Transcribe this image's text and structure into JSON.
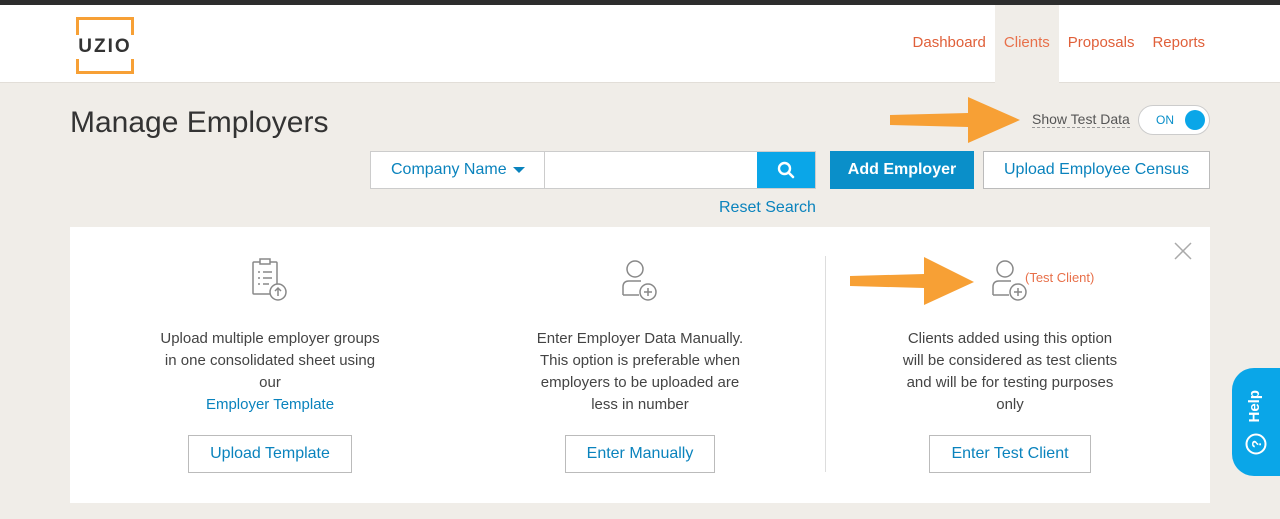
{
  "brand": {
    "logo_text": "UZIO",
    "accent": "#f7a035"
  },
  "nav": [
    {
      "label": "Dashboard",
      "active": false
    },
    {
      "label": "Clients",
      "active": true
    },
    {
      "label": "Proposals",
      "active": false
    },
    {
      "label": "Reports",
      "active": false
    }
  ],
  "page": {
    "title": "Manage Employers"
  },
  "test_data": {
    "label": "Show Test Data",
    "toggle_state": "ON"
  },
  "search": {
    "select_value": "Company Name",
    "input_value": "",
    "reset_label": "Reset Search"
  },
  "actions": {
    "add_employer": "Add Employer",
    "upload_census": "Upload Employee Census"
  },
  "options": {
    "template": {
      "line1": "Upload multiple employer groups",
      "line2": "in one consolidated sheet using",
      "line3": "our",
      "link": "Employer Template",
      "button": "Upload Template"
    },
    "manual": {
      "line1": "Enter Employer Data Manually.",
      "line2": "This option is preferable when",
      "line3": "employers to be uploaded are",
      "line4": "less in number",
      "button": "Enter Manually"
    },
    "test": {
      "badge": "(Test Client)",
      "line1": "Clients added using this option",
      "line2": "will be considered as test clients",
      "line3": "and will be for testing purposes",
      "line4": "only",
      "button": "Enter Test Client"
    }
  },
  "help": {
    "label": "Help"
  },
  "colors": {
    "primary": "#0a8fc9",
    "nav": "#e0603a",
    "arrow": "#f7a035"
  }
}
